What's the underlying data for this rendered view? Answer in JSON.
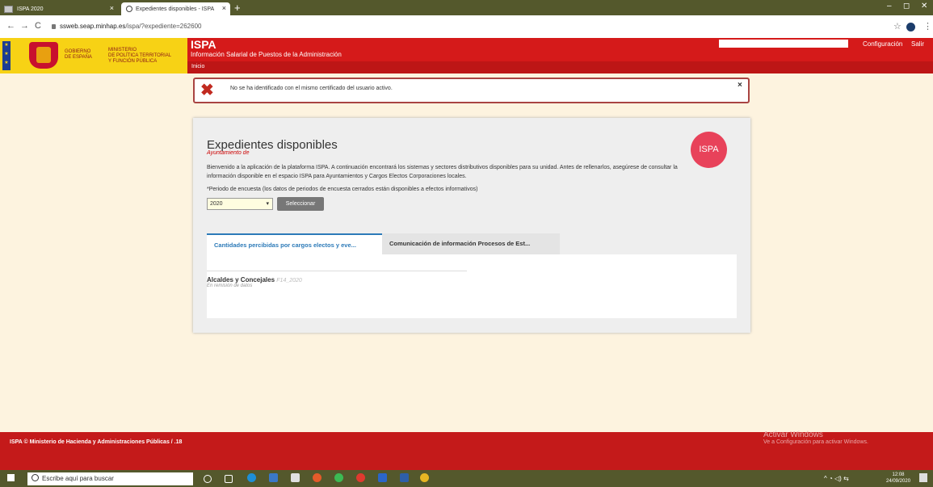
{
  "browser": {
    "tabs": [
      {
        "title": "ISPA 2020",
        "close": "×"
      },
      {
        "title": "Expedientes disponibles - ISPA",
        "close": "×"
      }
    ],
    "new_tab": "+",
    "window_controls": [
      "–",
      "◻",
      "✕"
    ],
    "url_host": "ssweb.seap.minhap.es",
    "url_path": "/ispa/?expediente=262600",
    "nav": {
      "back": "←",
      "forward": "→",
      "reload": "C"
    }
  },
  "header": {
    "gov_line1": "GOBIERNO",
    "gov_line2": "DE ESPAÑA",
    "min_line1": "MINISTERIO",
    "min_line2": "DE POLÍTICA TERRITORIAL",
    "min_line3": "Y FUNCIÓN PÚBLICA",
    "title": "ISPA",
    "subtitle": "Información Salarial de Puestos de la Administración",
    "nav_inicio": "Inicio",
    "config_link": "Configuración",
    "logout_link": "Salir"
  },
  "alert": {
    "message": "No se ha identificado con el mismo certificado del usuario activo.",
    "close": "×"
  },
  "panel": {
    "title": "Expedientes disponibles",
    "subtitle": "Ayuntamiento de",
    "badge": "ISPA",
    "intro": "Bienvenido a la aplicación de la plataforma ISPA. A continuación encontrará los sistemas y sectores distributivos disponibles para su unidad. Antes de rellenarlos, asegúrese de consultar la información disponible en el espacio ISPA para Ayuntamientos y Cargos Electos Corporaciones locales.",
    "period_label": "*Periodo de encuesta (los datos de periodos de encuesta cerrados están disponibles a efectos informativos)",
    "period_value": "2020",
    "select_button": "Seleccionar",
    "tabs": [
      {
        "label": "Cantidades percibidas por cargos electos y eve...",
        "active": true
      },
      {
        "label": "Comunicación de información Procesos de Est...",
        "active": false
      }
    ],
    "items": [
      {
        "name": "Alcaldes y Concejales",
        "code": "F14_2020",
        "status": "En remisión de datos"
      }
    ]
  },
  "footer": {
    "text": "ISPA © Ministerio de Hacienda y Administraciones Públicas / .18"
  },
  "watermark": {
    "line1": "Activar Windows",
    "line2": "Ve a Configuración para activar Windows."
  },
  "taskbar": {
    "search_placeholder": "Escribe aquí para buscar",
    "time": "12:08",
    "date": "24/09/2020"
  },
  "colors": {
    "header_red": "#d51a1a",
    "gov_yellow": "#f7d215",
    "tab_blue": "#2c7ab8",
    "taskbar": "#54582c"
  }
}
